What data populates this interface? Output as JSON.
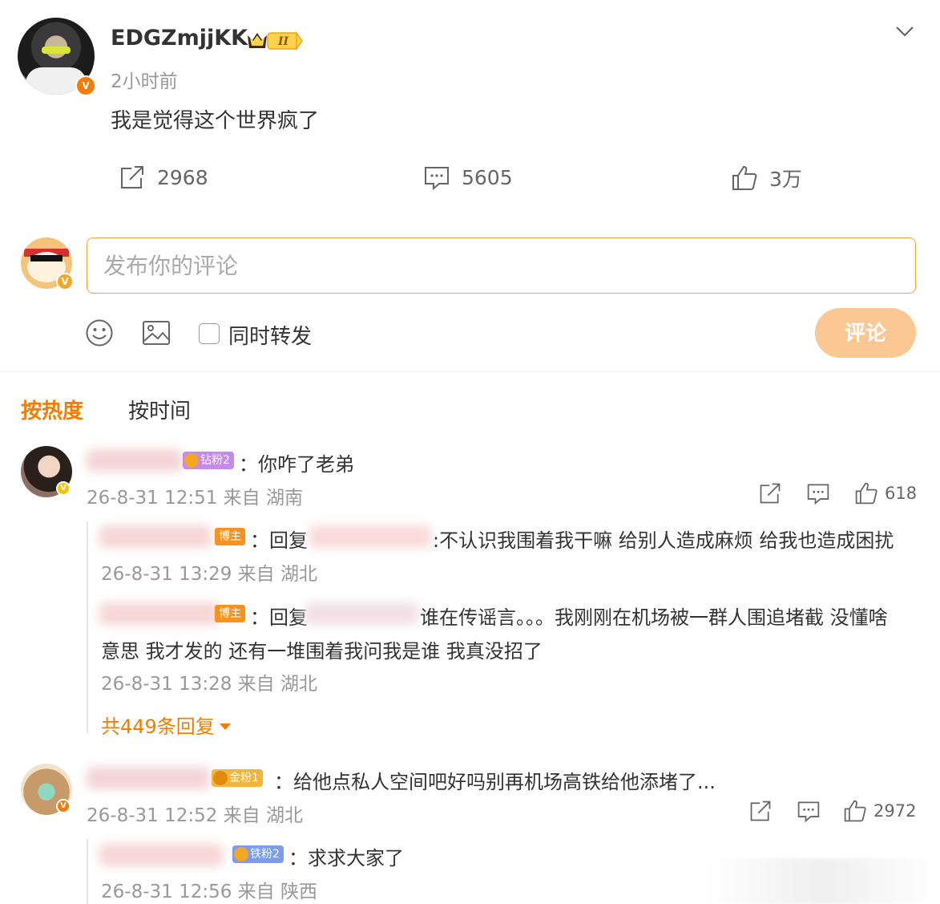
{
  "post": {
    "username": "EDGZmjjKK",
    "level_badge": "II",
    "time": "2小时前",
    "text": "我是觉得这个世界疯了",
    "reposts": "2968",
    "comments": "5605",
    "likes": "3万"
  },
  "composer": {
    "placeholder": "发布你的评论",
    "repost_label": "同时转发",
    "submit_label": "评论"
  },
  "sort": {
    "hot": "按热度",
    "time": "按时间"
  },
  "comments": [
    {
      "badge": "钻粉2",
      "text": "：你咋了老弟",
      "meta": "26-8-31 12:51 来自 湖南",
      "likes": "618",
      "replies": [
        {
          "badge": "博主",
          "text_pre": "：回复",
          "text_post": ":不认识我围着我干嘛 给别人造成麻烦 给我也造成困扰",
          "meta": "26-8-31 13:29 来自 湖北"
        },
        {
          "badge": "博主",
          "text_pre": "：回复",
          "text_post": "谁在传谣言。。。我刚刚在机场被一群人围追堵截 没懂啥",
          "text_line2": "意思 我才发的 还有一堆围着我问我是谁 我真没招了",
          "meta": "26-8-31 13:28 来自 湖北"
        }
      ],
      "more_replies": "共449条回复"
    },
    {
      "badge": "金粉1",
      "text": "：给他点私人空间吧好吗别再机场高铁给他添堵了...",
      "meta": "26-8-31 12:52 来自 湖北",
      "likes": "2972",
      "replies": [
        {
          "badge": "铁粉2",
          "text_pre": "：求求大家了",
          "meta": "26-8-31 12:56 来自 陕西"
        }
      ]
    }
  ],
  "colors": {
    "accent": "#f57c00",
    "input_border": "#f7a33b",
    "submit_bg": "#fbc793",
    "badge_diamond": "#c58af0",
    "badge_gold": "#f5b43a",
    "badge_iron": "#7b9cf0",
    "badge_blogger": "#f7931e"
  },
  "icons": [
    "chevron-down-icon",
    "repost-icon",
    "comment-icon",
    "like-icon",
    "emoji-icon",
    "image-icon"
  ]
}
